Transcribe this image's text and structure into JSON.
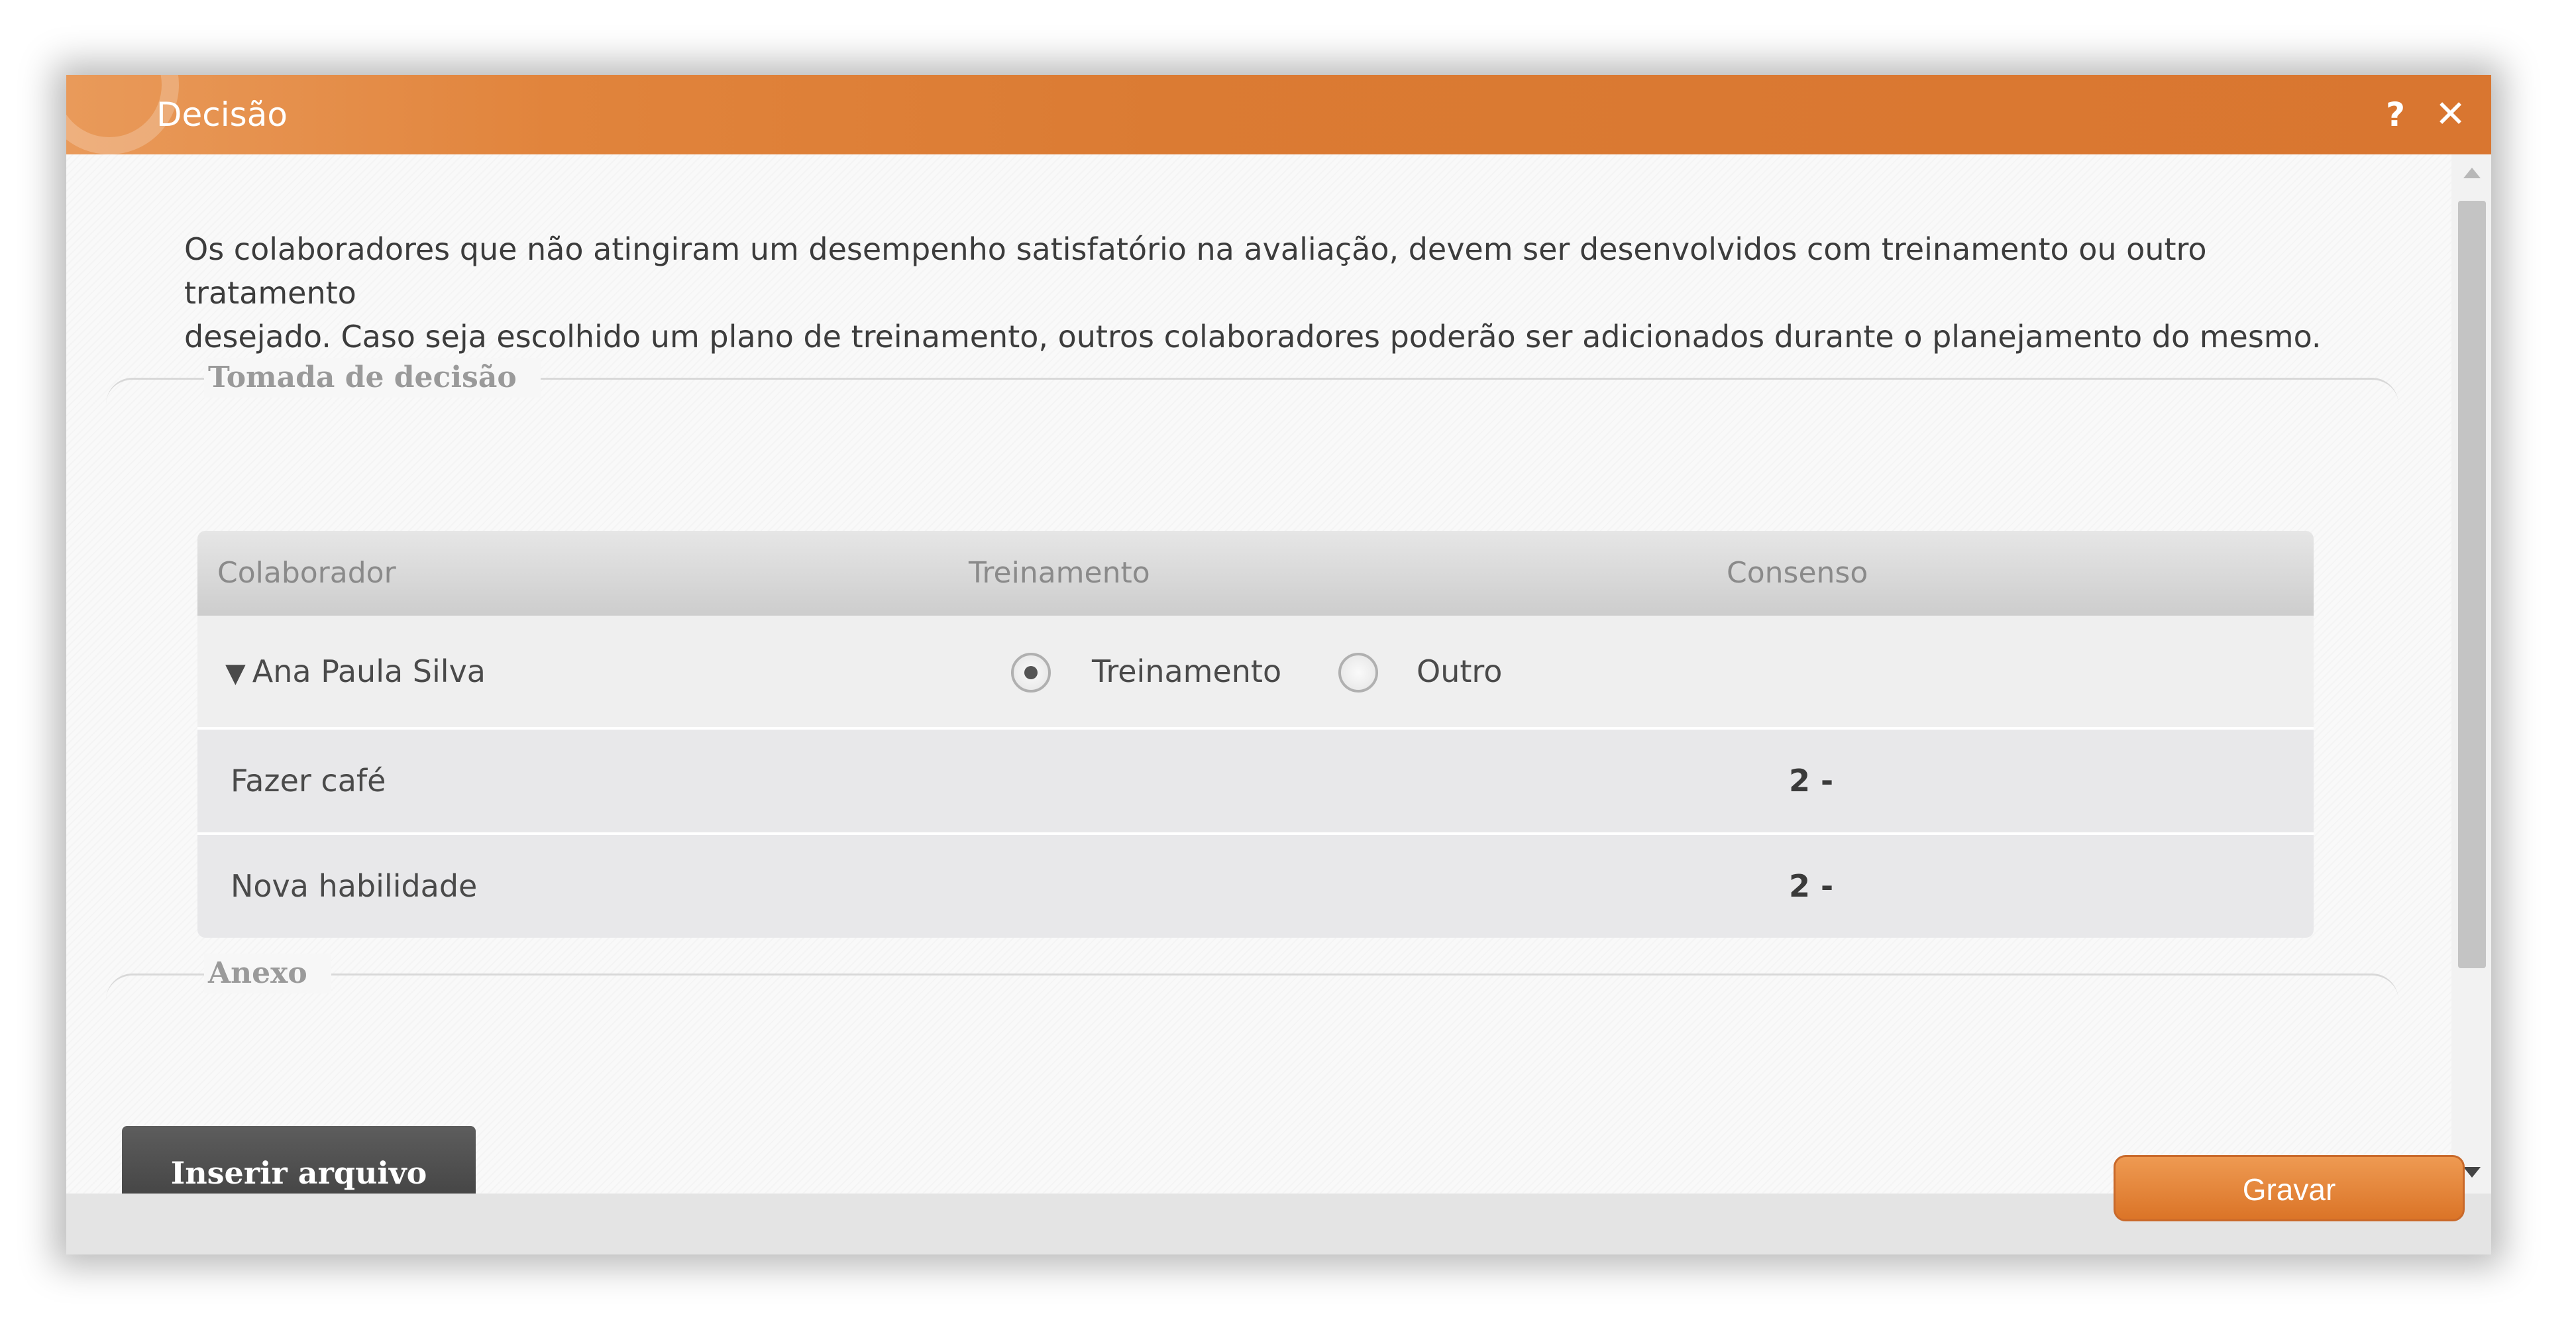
{
  "dialog": {
    "title": "Decisão",
    "help_label": "?",
    "close_label": "✕"
  },
  "intro": {
    "line1": "Os colaboradores que não atingiram um desempenho satisfatório na avaliação, devem ser desenvolvidos com treinamento ou outro tratamento",
    "line2": "desejado. Caso seja escolhido um plano de treinamento, outros colaboradores poderão ser adicionados durante o planejamento do mesmo."
  },
  "decision_section": {
    "label": "Tomada de decisão"
  },
  "table": {
    "columns": [
      "Colaborador",
      "Treinamento",
      "Consenso"
    ],
    "group": {
      "caret": "▼",
      "name": "Ana Paula Silva",
      "options": [
        {
          "label": "Treinamento",
          "checked": true
        },
        {
          "label": "Outro",
          "checked": false
        }
      ]
    },
    "rows": [
      {
        "skill": "Fazer café",
        "consensus": "2 -"
      },
      {
        "skill": "Nova habilidade",
        "consensus": "2 -"
      }
    ]
  },
  "attachment_section": {
    "label": "Anexo",
    "insert_button": "Inserir arquivo"
  },
  "footer": {
    "save_button": "Gravar"
  },
  "colors": {
    "title_bar": "#d97630",
    "save_button": "#e0802f"
  }
}
